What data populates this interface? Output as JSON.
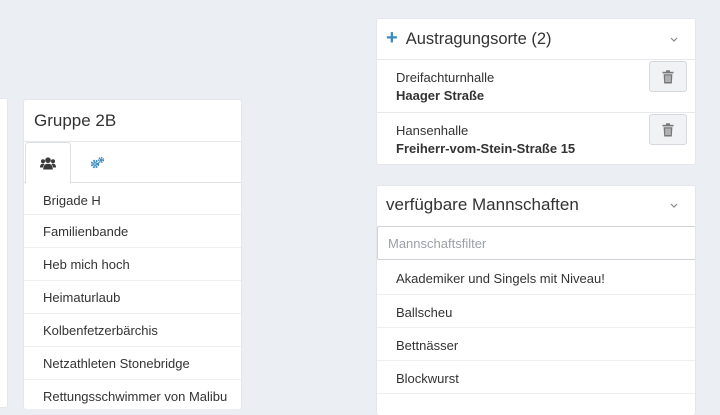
{
  "group": {
    "title": "Gruppe 2B",
    "tabs": [
      {
        "icon": "users-icon",
        "active": true
      },
      {
        "icon": "gears-icon",
        "active": false
      }
    ],
    "teams": [
      "Brigade H",
      "Familienbande",
      "Heb mich hoch",
      "Heimaturlaub",
      "Kolbenfetzerbärchis",
      "Netzathleten Stonebridge",
      "Rettungsschwimmer von Malibu"
    ]
  },
  "venues": {
    "add_symbol": "+",
    "title": "Austragungsorte (2)",
    "items": [
      {
        "name": "Dreifachturnhalle",
        "street": "Haager Straße"
      },
      {
        "name": "Hansenhalle",
        "street": "Freiherr-vom-Stein-Straße 15"
      }
    ]
  },
  "available_teams": {
    "title": "verfügbare Mannschaften",
    "filter_placeholder": "Mannschaftsfilter",
    "items": [
      "Akademiker und Singels mit Niveau!",
      "Ballscheu",
      "Bettnässer",
      "Blockwurst"
    ]
  },
  "colors": {
    "accent": "#3b89c4",
    "background": "#ebeef2",
    "icon_dark": "#3a3a3a",
    "trash": "#777777"
  }
}
